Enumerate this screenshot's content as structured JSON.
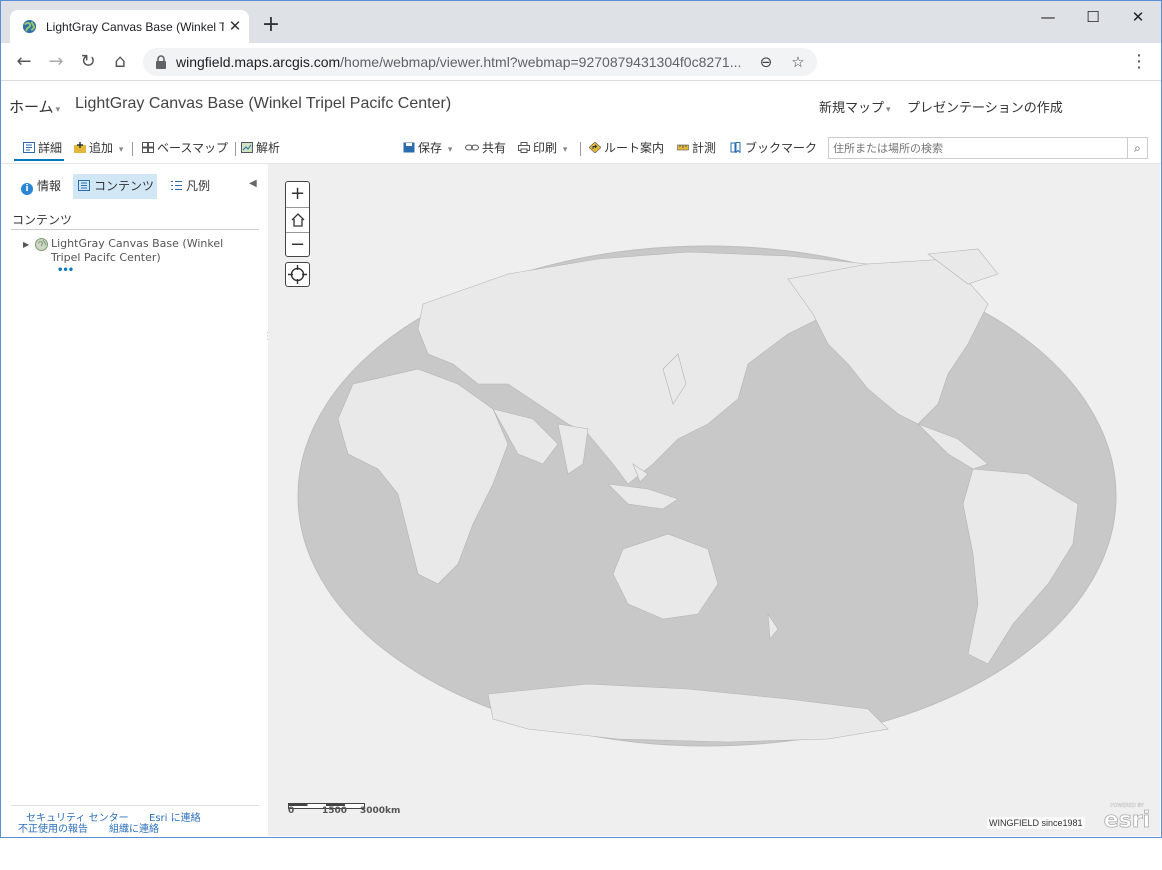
{
  "browser": {
    "tab_title": "LightGray Canvas Base (Winkel Tr",
    "tab_close": "✕",
    "new_tab": "+",
    "minimize": "—",
    "maximize": "☐",
    "close": "✕",
    "back": "←",
    "forward": "→",
    "reload": "↻",
    "home": "⌂",
    "url_host": "wingfield.maps.arcgis.com",
    "url_rest": "/home/webmap/viewer.html?webmap=9270879431304f0c8271...",
    "zoom_icon": "⊖",
    "star_icon": "☆",
    "menu": "⋮"
  },
  "header": {
    "home": "ホーム",
    "caret": "▾",
    "map_title": "LightGray Canvas Base (Winkel Tripel Pacifc Center)",
    "new_map": "新規マップ",
    "create_presentation": "プレゼンテーションの作成"
  },
  "toolbar": {
    "details": "詳細",
    "add": "追加",
    "basemap": "ベースマップ",
    "analysis": "解析",
    "save": "保存",
    "share": "共有",
    "print": "印刷",
    "directions": "ルート案内",
    "measure": "計測",
    "bookmarks": "ブックマーク",
    "search_placeholder": "住所または場所の検索",
    "search_icon": "⌕",
    "dropdown": "▾"
  },
  "sidebar": {
    "tabs": {
      "about": "情報",
      "content": "コンテンツ",
      "legend": "凡例"
    },
    "info_glyph": "i",
    "collapse": "◀",
    "contents_heading": "コンテンツ",
    "layer": {
      "toggle": "▶",
      "name": "LightGray Canvas Base (Winkel Tripel Pacifc Center)",
      "more": "•••"
    },
    "footer": {
      "security_center": "セキュリティ センター",
      "contact_esri": "Esri に連絡",
      "report_abuse": "不正使用の報告",
      "contact_org": "組織に連絡"
    }
  },
  "map": {
    "zoom_in": "+",
    "zoom_out": "−",
    "scale_labels": [
      "0",
      "1500",
      "3000km"
    ],
    "attribution": "WINGFIELD since1981",
    "esri_logo_text": "esri",
    "esri_powered": "POWERED BY"
  },
  "colors": {
    "accent": "#0079c1",
    "map_background": "#efefef",
    "ocean": "#c8c8c8",
    "land": "#e8e8e8",
    "tab_bar": "#dee1e6"
  }
}
